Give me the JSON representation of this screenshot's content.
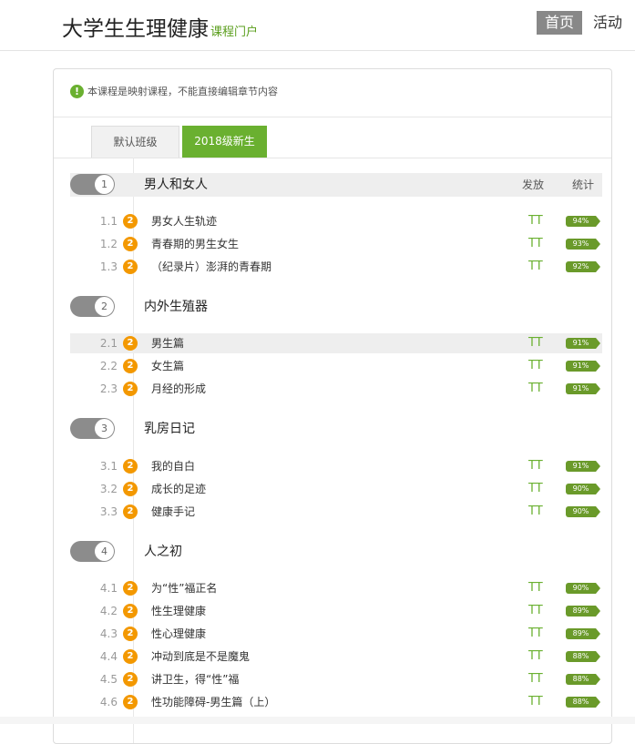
{
  "header": {
    "site_title": "大学生生理健康",
    "site_subtitle": "课程门户",
    "nav": {
      "home": "首页",
      "activity": "活动"
    }
  },
  "notice": {
    "icon": "info-icon",
    "text": "本课程是映射课程，不能直接编辑章节内容"
  },
  "tabs": [
    {
      "label": "默认班级",
      "active": false
    },
    {
      "label": "2018级新生",
      "active": true
    }
  ],
  "columns": {
    "publish": "发放",
    "stats": "统计"
  },
  "colors": {
    "accent": "#6ab030",
    "badge": "#f39800",
    "toggle": "#8c8c8c"
  },
  "chapters": [
    {
      "number": "1",
      "title": "男人和女人",
      "sections": [
        {
          "num": "1.1",
          "badge": "2",
          "name": "男女人生轨迹",
          "publish": "TT",
          "pct": "94%"
        },
        {
          "num": "1.2",
          "badge": "2",
          "name": "青春期的男生女生",
          "publish": "TT",
          "pct": "93%"
        },
        {
          "num": "1.3",
          "badge": "2",
          "name": "（纪录片）澎湃的青春期",
          "publish": "TT",
          "pct": "92%"
        }
      ]
    },
    {
      "number": "2",
      "title": "内外生殖器",
      "sections": [
        {
          "num": "2.1",
          "badge": "2",
          "name": "男生篇",
          "publish": "TT",
          "pct": "91%"
        },
        {
          "num": "2.2",
          "badge": "2",
          "name": "女生篇",
          "publish": "TT",
          "pct": "91%"
        },
        {
          "num": "2.3",
          "badge": "2",
          "name": "月经的形成",
          "publish": "TT",
          "pct": "91%"
        }
      ]
    },
    {
      "number": "3",
      "title": "乳房日记",
      "sections": [
        {
          "num": "3.1",
          "badge": "2",
          "name": "我的自白",
          "publish": "TT",
          "pct": "91%"
        },
        {
          "num": "3.2",
          "badge": "2",
          "name": "成长的足迹",
          "publish": "TT",
          "pct": "90%"
        },
        {
          "num": "3.3",
          "badge": "2",
          "name": "健康手记",
          "publish": "TT",
          "pct": "90%"
        }
      ]
    },
    {
      "number": "4",
      "title": "人之初",
      "sections": [
        {
          "num": "4.1",
          "badge": "2",
          "name": "为“性”福正名",
          "publish": "TT",
          "pct": "90%"
        },
        {
          "num": "4.2",
          "badge": "2",
          "name": "性生理健康",
          "publish": "TT",
          "pct": "89%"
        },
        {
          "num": "4.3",
          "badge": "2",
          "name": "性心理健康",
          "publish": "TT",
          "pct": "89%"
        },
        {
          "num": "4.4",
          "badge": "2",
          "name": "冲动到底是不是魔鬼",
          "publish": "TT",
          "pct": "88%"
        },
        {
          "num": "4.5",
          "badge": "2",
          "name": "讲卫生，得“性”福",
          "publish": "TT",
          "pct": "88%"
        },
        {
          "num": "4.6",
          "badge": "2",
          "name": "性功能障碍-男生篇（上）",
          "publish": "TT",
          "pct": "88%"
        }
      ]
    }
  ]
}
